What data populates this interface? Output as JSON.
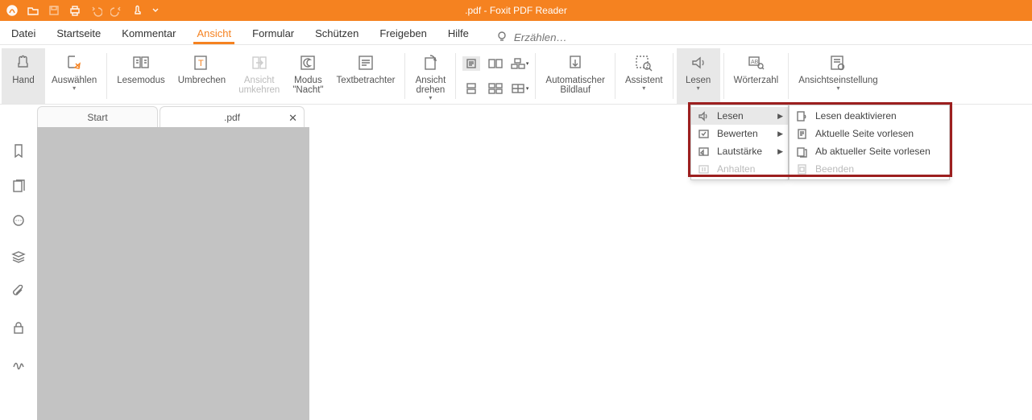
{
  "window_title": ".pdf - Foxit PDF Reader",
  "menu_tabs": {
    "datei": "Datei",
    "startseite": "Startseite",
    "kommentar": "Kommentar",
    "ansicht": "Ansicht",
    "formular": "Formular",
    "schuetzen": "Schützen",
    "freigeben": "Freigeben",
    "hilfe": "Hilfe"
  },
  "search_placeholder": "Erzählen…",
  "ribbon": {
    "hand": "Hand",
    "auswaehlen": "Auswählen",
    "lesemodus": "Lesemodus",
    "umbrechen": "Umbrechen",
    "ansicht_umkehren_l1": "Ansicht",
    "ansicht_umkehren_l2": "umkehren",
    "modus_nacht_l1": "Modus",
    "modus_nacht_l2": "\"Nacht\"",
    "textbetrachter": "Textbetrachter",
    "ansicht_drehen_l1": "Ansicht",
    "ansicht_drehen_l2": "drehen",
    "auto_bildlauf_l1": "Automatischer",
    "auto_bildlauf_l2": "Bildlauf",
    "assistent": "Assistent",
    "lesen": "Lesen",
    "woerterzahl": "Wörterzahl",
    "ansichtseinstellung": "Ansichtseinstellung"
  },
  "doc_tabs": {
    "start": "Start",
    "pdf": ".pdf"
  },
  "menu1": {
    "lesen": "Lesen",
    "bewerten": "Bewerten",
    "lautstaerke": "Lautstärke",
    "anhalten": "Anhalten"
  },
  "menu2": {
    "deaktivieren": "Lesen deaktivieren",
    "aktuelle_seite": "Aktuelle Seite vorlesen",
    "ab_aktueller": "Ab aktueller Seite vorlesen",
    "beenden": "Beenden"
  }
}
